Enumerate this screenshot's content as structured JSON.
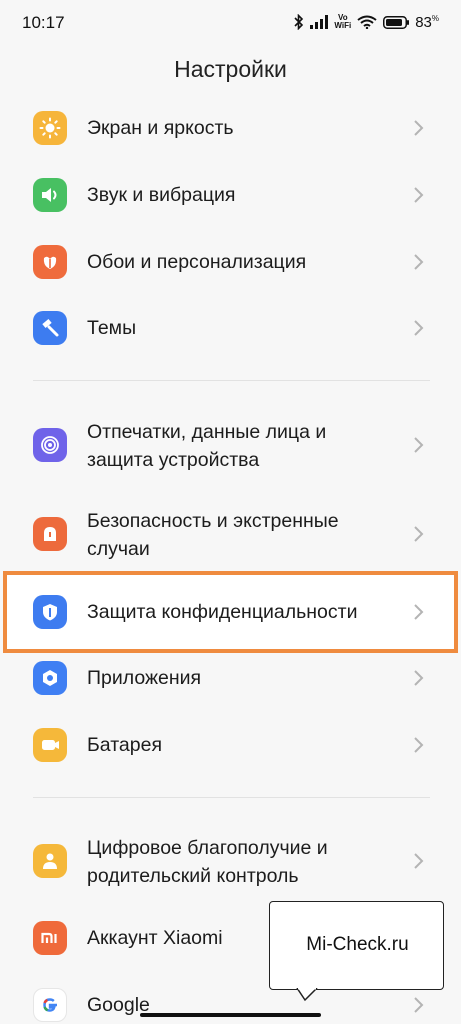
{
  "status_bar": {
    "time": "10:17",
    "vo": "Vo",
    "wifi": "WiFi",
    "battery": "83",
    "battery_unit": "%"
  },
  "title": "Настройки",
  "groups": [
    [
      {
        "label": "Экран и яркость",
        "icon": "sun-icon",
        "color": "#f6b53b"
      },
      {
        "label": "Звук и вибрация",
        "icon": "speaker-icon",
        "color": "#48c062"
      },
      {
        "label": "Обои и персонализация",
        "icon": "flower-icon",
        "color": "#ef6b3c"
      },
      {
        "label": "Темы",
        "icon": "paintbrush-icon",
        "color": "#3d7cf0"
      }
    ],
    [
      {
        "label": "Отпечатки, данные лица и защита устройства",
        "icon": "fingerprint-icon",
        "color": "#6f63e9"
      },
      {
        "label": "Безопасность и экстренные случаи",
        "icon": "emergency-icon",
        "color": "#ed6a3c"
      },
      {
        "label": "Защита конфиденциальности",
        "icon": "privacy-shield-icon",
        "color": "#3e7cf0",
        "highlighted": true
      },
      {
        "label": "Приложения",
        "icon": "apps-icon",
        "color": "#3f7ff3"
      },
      {
        "label": "Батарея",
        "icon": "battery-icon",
        "color": "#f5b83a"
      }
    ],
    [
      {
        "label": "Цифровое благополучие и родительский контроль",
        "icon": "wellbeing-icon",
        "color": "#f5b83a"
      },
      {
        "label": "Аккаунт Xiaomi",
        "icon": "xiaomi-icon",
        "color": "#ef6a3b"
      },
      {
        "label": "Google",
        "icon": "google-icon",
        "color": "#ffffff"
      }
    ]
  ],
  "watermark": {
    "text": "Mi-Check.ru"
  },
  "accents": {
    "highlight": "#ef8b3f"
  }
}
